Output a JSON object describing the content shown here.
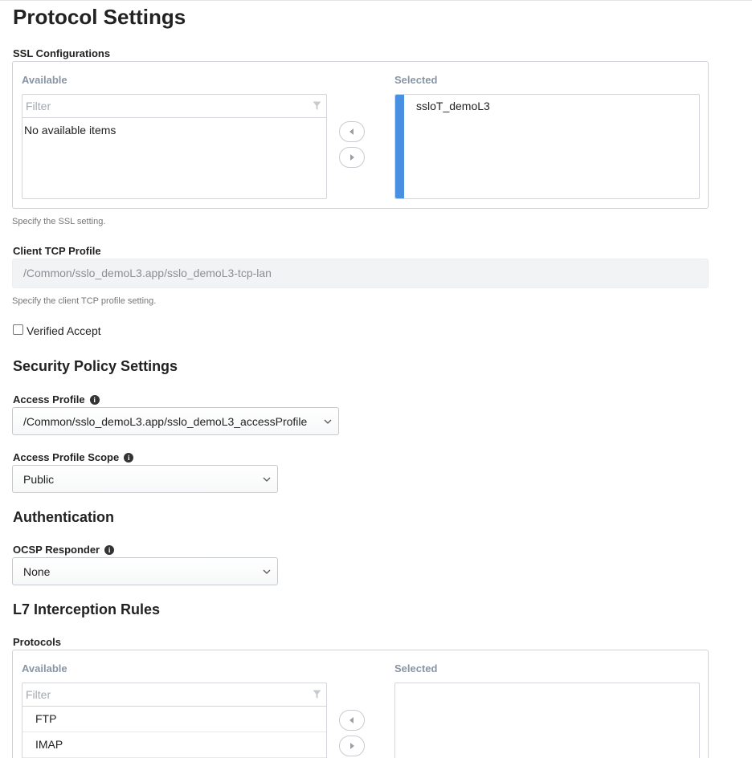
{
  "page": {
    "title": "Protocol Settings"
  },
  "ssl": {
    "label": "SSL Configurations",
    "available_header": "Available",
    "selected_header": "Selected",
    "filter_placeholder": "Filter",
    "empty_message": "No available items",
    "selected_items": [
      "ssloT_demoL3"
    ],
    "help": "Specify the SSL setting."
  },
  "client_tcp": {
    "label": "Client TCP Profile",
    "value": "/Common/sslo_demoL3.app/sslo_demoL3-tcp-lan",
    "help": "Specify the client TCP profile setting."
  },
  "verified_accept": {
    "label": "Verified Accept",
    "checked": false
  },
  "security_policy": {
    "title": "Security Policy Settings",
    "access_profile": {
      "label": "Access Profile",
      "value": "/Common/sslo_demoL3.app/sslo_demoL3_accessProfile"
    },
    "access_scope": {
      "label": "Access Profile Scope",
      "value": "Public"
    }
  },
  "authentication": {
    "title": "Authentication",
    "ocsp": {
      "label": "OCSP Responder",
      "value": "None"
    }
  },
  "l7": {
    "title": "L7 Interception Rules",
    "protocols_label": "Protocols",
    "available_header": "Available",
    "selected_header": "Selected",
    "filter_placeholder": "Filter",
    "available_items": [
      "FTP",
      "IMAP"
    ]
  },
  "icons": {
    "filter": "filter-icon",
    "move_left": "arrow-left-icon",
    "move_right": "arrow-right-icon",
    "info": "info-icon",
    "dropdown": "chevron-down-icon"
  },
  "colors": {
    "accent": "#4a90e2",
    "column_header": "#8a95a3"
  }
}
